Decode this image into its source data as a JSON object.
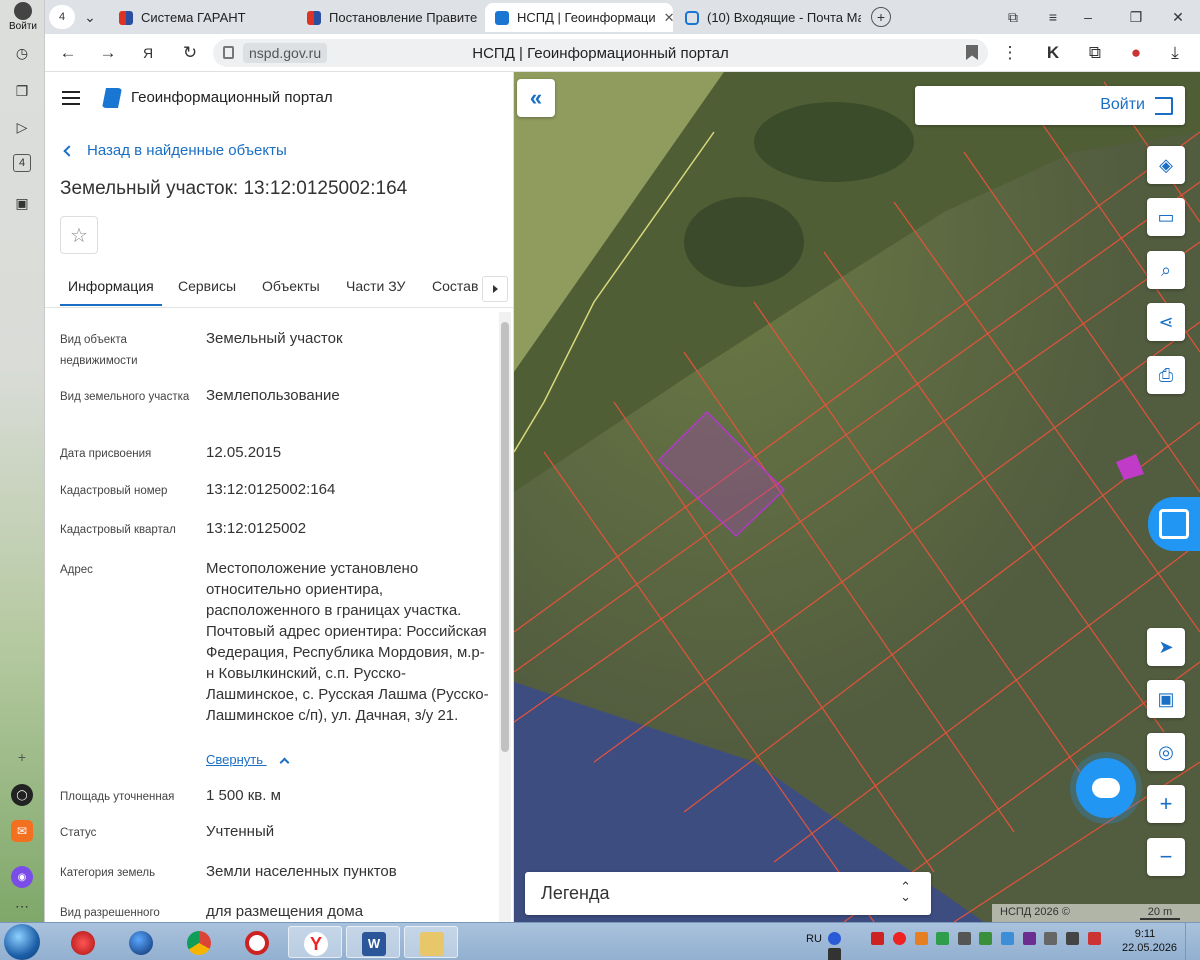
{
  "rail": {
    "login_label": "Войти",
    "badge": "4"
  },
  "tabs": [
    {
      "label": "Система ГАРАНТ",
      "active": false
    },
    {
      "label": "Постановление Правител",
      "active": false
    },
    {
      "label": "НСПД | Геоинформаци",
      "active": true,
      "close": "✕"
    },
    {
      "label": "(10) Входящие - Почта Ма",
      "active": false
    }
  ],
  "tab_count": "4",
  "address": {
    "domain": "nspd.gov.ru",
    "page_title": "НСПД | Геоинформационный портал"
  },
  "panel": {
    "app_title": "Геоинформационный портал",
    "back_link": "Назад в найденные объекты",
    "object_title": "Земельный участок: 13:12:0125002:164",
    "star": "☆",
    "tabs": [
      "Информация",
      "Сервисы",
      "Объекты",
      "Части ЗУ",
      "Состав"
    ],
    "fields": [
      {
        "label": "Вид объекта недвижимости",
        "value": "Земельный участок"
      },
      {
        "label": "Вид земельного участка",
        "value": "Землепользование"
      },
      {
        "label": "Дата присвоения",
        "value": "12.05.2015"
      },
      {
        "label": "Кадастровый номер",
        "value": "13:12:0125002:164"
      },
      {
        "label": "Кадастровый квартал",
        "value": "13:12:0125002"
      },
      {
        "label": "Адрес",
        "value": "Местоположение установлено относительно ориентира, расположенного в границах участка. Почтовый адрес ориентира: Российская Федерация, Республика Мордовия, м.р-н Ковылкинский, с.п. Русско-Лашминское, с. Русская Лашма (Русско-Лашминское с/п), ул. Дачная, з/у 21."
      },
      {
        "label": "Площадь уточненная",
        "value": "1 500 кв. м"
      },
      {
        "label": "Статус",
        "value": "Учтенный"
      },
      {
        "label": "Категория земель",
        "value": "Земли населенных пунктов"
      },
      {
        "label": "Вид разрешенного",
        "value": "для размещения дома"
      }
    ],
    "collapse_link": "Свернуть"
  },
  "map": {
    "collapse_btn": "«",
    "login_btn": "Войти",
    "legend_label": "Легенда",
    "copyright": "НСПД 2026 ©",
    "scale": "20 m",
    "tools": [
      "layers-icon",
      "ruler-icon",
      "search-area-icon",
      "share-icon",
      "print-icon",
      "locate-icon",
      "minimap-icon",
      "geo-search-icon",
      "zoom-in-icon",
      "zoom-out-icon"
    ],
    "zoom_in": "+",
    "zoom_out": "−"
  },
  "taskbar": {
    "lang": "RU",
    "time": "9:11",
    "date": "22.05.2026"
  },
  "colors": {
    "accent": "#1a6fc4",
    "parcel_line": "#e2533a",
    "selected_parcel": "#b03ac8"
  }
}
